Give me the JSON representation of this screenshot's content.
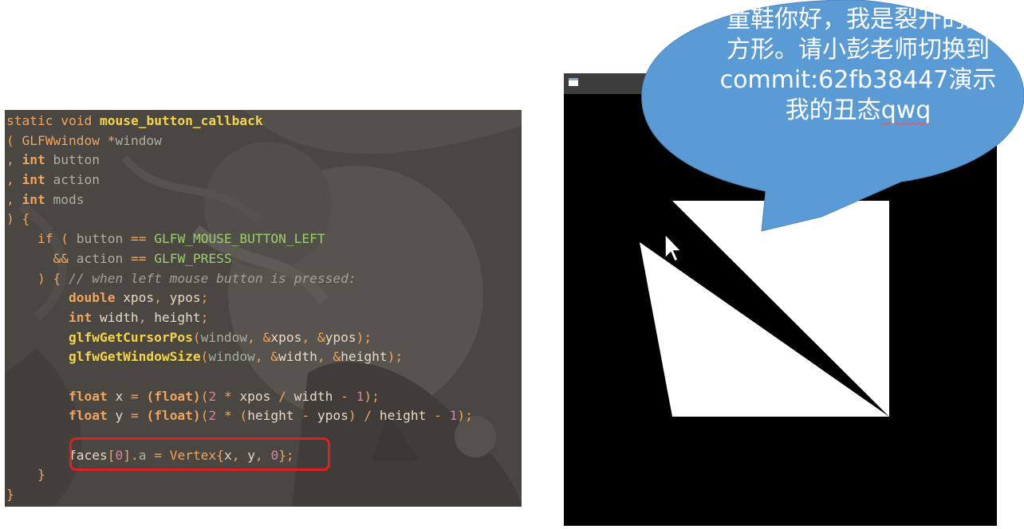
{
  "code_editor": {
    "lines": [
      [
        {
          "t": "static ",
          "c": "kw"
        },
        {
          "t": "void ",
          "c": "kw"
        },
        {
          "t": "mouse_button_callback",
          "c": "fn"
        }
      ],
      [
        {
          "t": "( ",
          "c": "pu"
        },
        {
          "t": "GLFWwindow ",
          "c": "kw"
        },
        {
          "t": "*",
          "c": "op"
        },
        {
          "t": "window",
          "c": "pa"
        }
      ],
      [
        {
          "t": ", ",
          "c": "pu"
        },
        {
          "t": "int ",
          "c": "ty"
        },
        {
          "t": "button",
          "c": "pa"
        }
      ],
      [
        {
          "t": ", ",
          "c": "pu"
        },
        {
          "t": "int ",
          "c": "ty"
        },
        {
          "t": "action",
          "c": "pa"
        }
      ],
      [
        {
          "t": ", ",
          "c": "pu"
        },
        {
          "t": "int ",
          "c": "ty"
        },
        {
          "t": "mods",
          "c": "pa"
        }
      ],
      [
        {
          "t": ") {",
          "c": "pu"
        }
      ],
      [
        {
          "t": "    if ",
          "c": "kw"
        },
        {
          "t": "( ",
          "c": "pu"
        },
        {
          "t": "button ",
          "c": "pa"
        },
        {
          "t": "== ",
          "c": "op"
        },
        {
          "t": "GLFW_MOUSE_BUTTON_LEFT",
          "c": "mc"
        }
      ],
      [
        {
          "t": "      && ",
          "c": "op"
        },
        {
          "t": "action ",
          "c": "pa"
        },
        {
          "t": "== ",
          "c": "op"
        },
        {
          "t": "GLFW_PRESS",
          "c": "mc"
        }
      ],
      [
        {
          "t": "    ) { ",
          "c": "pu"
        },
        {
          "t": "// when left mouse button is pressed:",
          "c": "cm"
        }
      ],
      [
        {
          "t": "        double ",
          "c": "ty"
        },
        {
          "t": "xpos",
          "c": "id"
        },
        {
          "t": ", ",
          "c": "pu"
        },
        {
          "t": "ypos",
          "c": "id"
        },
        {
          "t": ";",
          "c": "pu"
        }
      ],
      [
        {
          "t": "        int ",
          "c": "ty"
        },
        {
          "t": "width",
          "c": "id"
        },
        {
          "t": ", ",
          "c": "pu"
        },
        {
          "t": "height",
          "c": "id"
        },
        {
          "t": ";",
          "c": "pu"
        }
      ],
      [
        {
          "t": "        glfwGetCursorPos",
          "c": "fn"
        },
        {
          "t": "(",
          "c": "pu"
        },
        {
          "t": "window",
          "c": "pa"
        },
        {
          "t": ", ",
          "c": "pu"
        },
        {
          "t": "&",
          "c": "op"
        },
        {
          "t": "xpos",
          "c": "id"
        },
        {
          "t": ", ",
          "c": "pu"
        },
        {
          "t": "&",
          "c": "op"
        },
        {
          "t": "ypos",
          "c": "id"
        },
        {
          "t": ");",
          "c": "pu"
        }
      ],
      [
        {
          "t": "        glfwGetWindowSize",
          "c": "fn"
        },
        {
          "t": "(",
          "c": "pu"
        },
        {
          "t": "window",
          "c": "pa"
        },
        {
          "t": ", ",
          "c": "pu"
        },
        {
          "t": "&",
          "c": "op"
        },
        {
          "t": "width",
          "c": "id"
        },
        {
          "t": ", ",
          "c": "pu"
        },
        {
          "t": "&",
          "c": "op"
        },
        {
          "t": "height",
          "c": "id"
        },
        {
          "t": ");",
          "c": "pu"
        }
      ],
      [],
      [
        {
          "t": "        float ",
          "c": "ty"
        },
        {
          "t": "x ",
          "c": "id"
        },
        {
          "t": "= ",
          "c": "op"
        },
        {
          "t": "(float)",
          "c": "ty"
        },
        {
          "t": "(",
          "c": "pu"
        },
        {
          "t": "2 ",
          "c": "nu"
        },
        {
          "t": "* ",
          "c": "op"
        },
        {
          "t": "xpos ",
          "c": "id"
        },
        {
          "t": "/ ",
          "c": "op"
        },
        {
          "t": "width ",
          "c": "id"
        },
        {
          "t": "- ",
          "c": "op"
        },
        {
          "t": "1",
          "c": "nu"
        },
        {
          "t": ");",
          "c": "pu"
        }
      ],
      [
        {
          "t": "        float ",
          "c": "ty"
        },
        {
          "t": "y ",
          "c": "id"
        },
        {
          "t": "= ",
          "c": "op"
        },
        {
          "t": "(float)",
          "c": "ty"
        },
        {
          "t": "(",
          "c": "pu"
        },
        {
          "t": "2 ",
          "c": "nu"
        },
        {
          "t": "* ",
          "c": "op"
        },
        {
          "t": "(",
          "c": "pu"
        },
        {
          "t": "height ",
          "c": "id"
        },
        {
          "t": "- ",
          "c": "op"
        },
        {
          "t": "ypos",
          "c": "id"
        },
        {
          "t": ") ",
          "c": "pu"
        },
        {
          "t": "/ ",
          "c": "op"
        },
        {
          "t": "height ",
          "c": "id"
        },
        {
          "t": "- ",
          "c": "op"
        },
        {
          "t": "1",
          "c": "nu"
        },
        {
          "t": ");",
          "c": "pu"
        }
      ],
      [],
      [
        {
          "t": "        faces",
          "c": "id"
        },
        {
          "t": "[",
          "c": "pu"
        },
        {
          "t": "0",
          "c": "nu"
        },
        {
          "t": "]",
          "c": "pu"
        },
        {
          "t": ".",
          "c": "pu"
        },
        {
          "t": "a ",
          "c": "fd"
        },
        {
          "t": "= ",
          "c": "op"
        },
        {
          "t": "Vertex",
          "c": "kw"
        },
        {
          "t": "{",
          "c": "pu"
        },
        {
          "t": "x",
          "c": "id"
        },
        {
          "t": ", ",
          "c": "pu"
        },
        {
          "t": "y",
          "c": "id"
        },
        {
          "t": ", ",
          "c": "pu"
        },
        {
          "t": "0",
          "c": "nu"
        },
        {
          "t": "};",
          "c": "pu"
        }
      ],
      [
        {
          "t": "    }",
          "c": "pu"
        }
      ],
      [
        {
          "t": "}",
          "c": "pu"
        }
      ]
    ]
  },
  "gl_window": {
    "icon": "window-app-icon",
    "background_color": "#000000",
    "shape_color": "#ffffff"
  },
  "speech_bubble": {
    "color": "#5b9bd5",
    "lines": [
      "童鞋你好，我是裂开的正",
      "方形。请小彭老师切换到",
      "commit:62fb38447演示",
      "我的丑态"
    ],
    "squiggle_word": "qwq"
  },
  "cursor": {
    "icon": "mouse-pointer-icon"
  }
}
